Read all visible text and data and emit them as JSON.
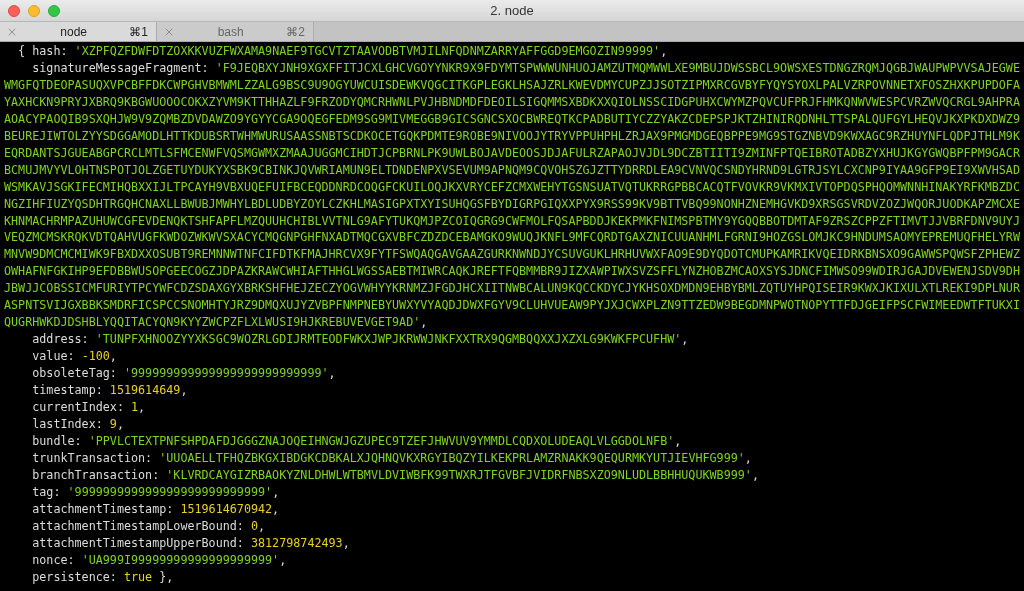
{
  "window": {
    "title": "2. node"
  },
  "tabs": [
    {
      "label": "node",
      "shortcut": "⌘1",
      "selected": true
    },
    {
      "label": "bash",
      "shortcut": "⌘2",
      "selected": false
    }
  ],
  "terminal": {
    "lines": [
      {
        "prefix": "{ ",
        "key": "hash:",
        "value": "'XZPFQZFDWFDTZOXKKVUZFWXAMA9NAEF9TGCVTZTAAVODBTVMJILNFQDNMZARRYAFFGGD9EMGOZIN99999'",
        "kind": "string",
        "suffix": ","
      },
      {
        "key": "signatureMessageFragment:",
        "value": "'F9JEQBXYJNH9XGXFFITJCXLGHCVGOYYNKR9X9FDYMTSPWWWUNHUOJAMZUTMQMWWLXE9MBUJDWSSBCL9OWSXESTDNGZRQMJQGBJWAUPWPVVSAJEGWEWMGFQTDEOPASUQXVPCBFFDKCWPGHVBMWMLZZALG9BSC9U9OGYUWCUISDEWKVQGCITKGPLEGKLHSAJZRLKWEVDMYCUPZJJSOTZIPMXRCGVBYFYQYSYOXLPALVZRPOVNNETXFOSZHXKPUPDOFAYAXHCKN9PRYJXBRQ9KBGWUOOOCOKXZYVM9KTTHHAZLF9FRZODYQMCRHWNLPVJHBNDMDFDEOILSIGQMMSXBDKXXQIOLNSSCIDGPUHXCWYMZPQVCUFPRJFHMKQNWVWESPCVRZWVQCRGL9AHPRAAOACYPAOQIB9SXQHJW9V9ZQMBZDVDAWZO9YGYYCGA9OQEGFEDM9SG9MIVMEGGB9GICSGNCSXOCBWREQTKCPADBUTIYCZZYAKZCDEPSPJKTZHINIRQDNHLTTSPALQUFGYLHEQVJKXPKDXDWZ9BEUREJIWTOLZYYSDGGAMODLHTTKDUBSRTWHMWURUSAASSNBTSCDKOCETGQKPDMTE9ROBE9NIVOOJYTRYVPPUHPHLZRJAX9PMGMDGEQBPPE9MG9STGZNBVD9KWXAGC9RZHUYNFLQDPJTHLM9KEQRDANTSJGUEABGPCRCLMTLSFMCENWFVQSMGWMXZMAAJUGGMCIHDTJCPBRNLPK9UWLBOJAVDEOOSJDJAFULRZAPAOJVJDL9DCZBTIITI9ZMINFPTQEIBROTADBZYXHUJKGYGWQBPFPM9GACRBCMUJMVYVLOHTNSPOTJOLZGETUYDUKYXSBK9CBINKJQVWRIAMUN9ELTDNDENPXVSEVUM9APNQM9CQVOHSZGJZTTYDRRDLEA9CVNVQCSNDYHRND9LGTRJSYLCXCNP9IYAA9GFP9EI9XWVHSADWSMKAVJSGKIFECMIHQBXXIJLTPCAYH9VBXUQEFUIFBCEQDDNRDCOQGFCKUILOQJKXVRYCEFZCMXWEHYTGSNSUATVQTUKRRGPBBCACQTFVOVKR9VKMXIVTOPDQSPHQOMWNNHINAKYRFKMBZDCNGZIHFIUZYQSDHTRGQHCNAXLLBWUBJMWHYLBDLUDBYZOYLCZKHLMASIGPXTXYISUHQGSFBYDIGRPGIQXXPYX9RSS99KV9BTTVBQ99NONHZNEMHGVKD9XRSGSVRDVZOZJWQORJUODKAPZMCXEKHNMACHRMPAZUHUWCGFEVDENQKTSHFAPFLMZQUUHCHIBLVVTNLG9AFYTUKQMJPZCOIQGRG9CWFMOLFQSAPBDDJKEKPMKFNIMSPBTMY9YGQQBBOTDMTAF9ZRSZCPPZFTIMVTJJVBRFDNV9UYJVEQZMCMSKRQKVDTQAHVUGFKWDOZWKWVSXACYCMQGNPGHFNXADTMQCGXVBFCZDZDCEBAMGKO9WUQJKNFL9MFCQRDTGAXZNICUUANHMLFGRNI9HOZGSLOMJKC9HNDUMSAOMYEPREMUQFHELYRWMNVW9DMCMCMIWK9FBXDXXOSUBT9REMNNWTNFCIFDTKFMAJHRCVX9FYTFSWQAQGAVGAAZGURKNWNDJYCSUVGUKLHRHUVWXFAO9E9DYQDOTCMUPKAMRIKVQEIDRKBNSXO9GAWWSPQWSFZPHEWZOWHAFNFGKIHP9EFDBBWUSOPGEECOGZJDPAZKRAWCWHIAFTHHGLWGSSAEBTMIWRCAQKJREFTFQBMMBR9JIZXAWPIWXSVZSFFLYNZHOBZMCAOXSYSJDNCFIMWSO99WDIRJGAJDVEWENJSDV9DHJBWJJCOBSSICMFURIYTPCYWFCDZSDAXGYXBRKSHFHEJZECZYOGVWHYYKRNMZJFGDJHCXIITNWBCALUN9KQCCKDYCJYKHSOXDMDN9EHBYBMLZQTUYHPQISEIR9KWXJKIXULXTLREKI9DPLNURASPNTSVIJGXBBKSMDRFICSPCCSNOMHTYJRZ9DMQXUJYZVBPFNMPNEBYUWXYVYAQDJDWXFGYV9CLUHVUEAW9PYJXJCWXPLZN9TTZEDW9BEGDMNPWOTNOPYTTFDJGEIFPSCFWIMEEDWTFTUKXIQUGRHWKDJDSHBLYQQITACYQN9KYYZWCPZFLXLWUSI9HJKREBUVEVGET9AD'",
        "kind": "string",
        "suffix": ","
      },
      {
        "key": "address:",
        "value": "'TUNPFXHNOOZYYXKSGC9WOZRLGDIJRMTEODFWKXJWPJKRWWJNKFXXTRX9QGMBQQXXJXZXLG9KWKFPCUFHW'",
        "kind": "string",
        "suffix": ","
      },
      {
        "key": "value:",
        "value": "-100",
        "kind": "number",
        "suffix": ","
      },
      {
        "key": "obsoleteTag:",
        "value": "'999999999999999999999999999'",
        "kind": "string",
        "suffix": ","
      },
      {
        "key": "timestamp:",
        "value": "1519614649",
        "kind": "number",
        "suffix": ","
      },
      {
        "key": "currentIndex:",
        "value": "1",
        "kind": "number",
        "suffix": ","
      },
      {
        "key": "lastIndex:",
        "value": "9",
        "kind": "number",
        "suffix": ","
      },
      {
        "key": "bundle:",
        "value": "'PPVLCTEXTPNFSHPDAFDJGGGZNAJOQEIHNGWJGZUPEC9TZEFJHWVUV9YMMDLCQDXOLUDEAQLVLGGDOLNFB'",
        "kind": "string",
        "suffix": ","
      },
      {
        "key": "trunkTransaction:",
        "value": "'UUOAELLTFHQZBKGXIBDGKCDBKALXJQHNQVKXRGYIBQZYILKEKPRLAMZRNAKK9QEQURMKYUTJIEVHFG999'",
        "kind": "string",
        "suffix": ","
      },
      {
        "key": "branchTransaction:",
        "value": "'KLVRDCAYGIZRBAOKYZNLDHWLWTBMVLDVIWBFK99TWXRJTFGVBFJVIDRFNBSXZO9NLUDLBBHHUQUKWB999'",
        "kind": "string",
        "suffix": ","
      },
      {
        "key": "tag:",
        "value": "'999999999999999999999999999'",
        "kind": "string",
        "suffix": ","
      },
      {
        "key": "attachmentTimestamp:",
        "value": "1519614670942",
        "kind": "number",
        "suffix": ","
      },
      {
        "key": "attachmentTimestampLowerBound:",
        "value": "0",
        "kind": "number",
        "suffix": ","
      },
      {
        "key": "attachmentTimestampUpperBound:",
        "value": "3812798742493",
        "kind": "number",
        "suffix": ","
      },
      {
        "key": "nonce:",
        "value": "'UA999I99999999999999999999'",
        "kind": "string",
        "suffix": ","
      },
      {
        "key": "persistence:",
        "value": "true",
        "kind": "boolean",
        "suffix": " },"
      }
    ]
  }
}
